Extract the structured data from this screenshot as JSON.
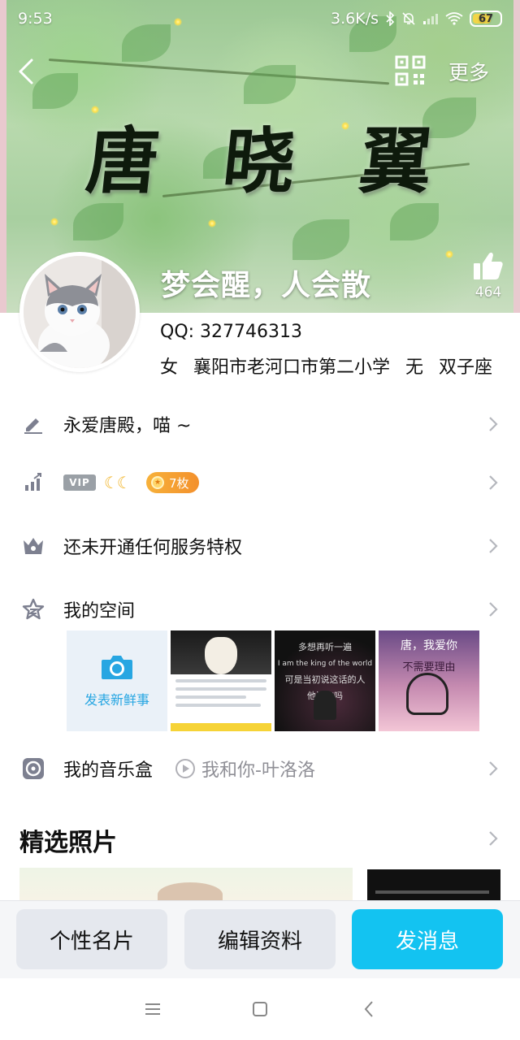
{
  "status_bar": {
    "time": "9:53",
    "network_speed": "3.6K/s",
    "battery": "67"
  },
  "cover": {
    "calligraphy": [
      "唐",
      "晓",
      "翼"
    ]
  },
  "top_bar": {
    "more_label": "更多"
  },
  "profile": {
    "nickname": "梦会醒，人会散",
    "likes": "464",
    "qq": "QQ: 327746313",
    "details": [
      "女",
      "襄阳市老河口市第二小学",
      "无",
      "双子座"
    ]
  },
  "rows": {
    "signature": "永爱唐殿，喵 ~",
    "vip_tag": "VIP",
    "moons": "☾☾",
    "medal_count": "7枚",
    "service": "还未开通任何服务特权",
    "space": "我的空间",
    "music_box": "我的音乐盒",
    "now_playing": "我和你-叶洛洛"
  },
  "space_thumbs": {
    "post_label": "发表新鲜事",
    "thumb3_lines": [
      "多想再听一遍",
      "I am the king of the world",
      "可是当初说这话的人",
      "他还在吗"
    ],
    "thumb4_lines": [
      "唐，我爱你",
      "不需要理由"
    ]
  },
  "featured": {
    "title": "精选照片"
  },
  "actions": {
    "card": "个性名片",
    "edit": "编辑资料",
    "message": "发消息"
  },
  "colors": {
    "accent": "#13c3f1",
    "icon_grey": "#7d8090",
    "medal_orange": "#f3902c"
  }
}
